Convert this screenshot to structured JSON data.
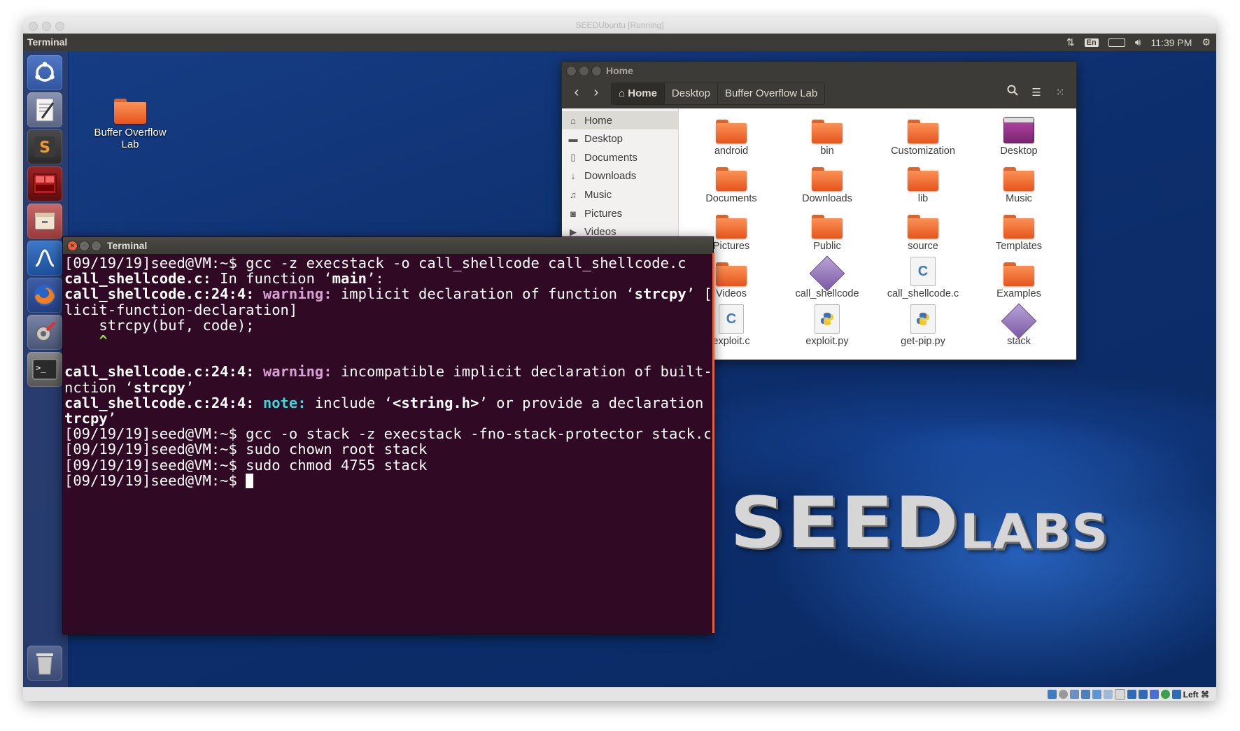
{
  "vm_window": {
    "title": "SEEDUbuntu [Running]"
  },
  "topbar": {
    "app_name": "Terminal",
    "keyboard_layout": "En",
    "clock": "11:39 PM",
    "icons": [
      "network-updown-icon",
      "keyboard-layout-icon",
      "battery-icon",
      "volume-icon",
      "power-gear-icon"
    ]
  },
  "launcher": {
    "items": [
      {
        "name": "ubuntu-dash-icon"
      },
      {
        "name": "text-editor-icon"
      },
      {
        "name": "sublime-text-icon"
      },
      {
        "name": "terminal-red-icon"
      },
      {
        "name": "file-manager-icon"
      },
      {
        "name": "wireshark-icon"
      },
      {
        "name": "firefox-icon"
      },
      {
        "name": "settings-icon"
      },
      {
        "name": "terminal-icon"
      },
      {
        "name": "trash-icon"
      }
    ]
  },
  "desktop": {
    "icon_label_line1": "Buffer Overflow",
    "icon_label_line2": "Lab"
  },
  "terminal": {
    "title": "Terminal",
    "lines": {
      "l1": "[09/19/19]seed@VM:~$ gcc -z execstack -o call_shellcode call_shellcode.c",
      "l2_file": "call_shellcode.c:",
      "l2_text": " In function ‘",
      "l2_func": "main",
      "l2_end": "’:",
      "l3_loc": "call_shellcode.c:24:4:",
      "l3_kind": " warning:",
      "l3_text": " implicit declaration of function ‘",
      "l3_func": "strcpy",
      "l3_end": "’ [-Wimp",
      "l4": "licit-function-declaration]",
      "l5": "    strcpy(buf, code);",
      "l6": "    ^",
      "l7": "",
      "l8_loc": "call_shellcode.c:24:4:",
      "l8_kind": " warning:",
      "l8_text": " incompatible implicit declaration of built-in fu",
      "l9_text": "nction ‘",
      "l9_func": "strcpy",
      "l9_end": "’",
      "l10_loc": "call_shellcode.c:24:4:",
      "l10_kind": " note:",
      "l10_text": " include ‘",
      "l10_hdr": "<string.h>",
      "l10_mid": "’ or provide a declaration of ‘",
      "l10_s": "s",
      "l11_func": "trcpy",
      "l11_end": "’",
      "l12": "[09/19/19]seed@VM:~$ gcc -o stack -z execstack -fno-stack-protector stack.c",
      "l13": "[09/19/19]seed@VM:~$ sudo chown root stack",
      "l14": "[09/19/19]seed@VM:~$ sudo chmod 4755 stack",
      "l15": "[09/19/19]seed@VM:~$ "
    }
  },
  "file_manager": {
    "title": "Home",
    "breadcrumbs": [
      "Home",
      "Desktop",
      "Buffer Overflow Lab"
    ],
    "sidebar": [
      {
        "label": "Home",
        "icon": "home-icon"
      },
      {
        "label": "Desktop",
        "icon": "desktop-icon"
      },
      {
        "label": "Documents",
        "icon": "document-icon"
      },
      {
        "label": "Downloads",
        "icon": "download-icon"
      },
      {
        "label": "Music",
        "icon": "music-icon"
      },
      {
        "label": "Pictures",
        "icon": "camera-icon"
      },
      {
        "label": "Videos",
        "icon": "video-icon"
      }
    ],
    "items": [
      {
        "label": "android",
        "kind": "folder"
      },
      {
        "label": "bin",
        "kind": "folder"
      },
      {
        "label": "Customization",
        "kind": "folder"
      },
      {
        "label": "Desktop",
        "kind": "desktop-folder"
      },
      {
        "label": "Documents",
        "kind": "folder"
      },
      {
        "label": "Downloads",
        "kind": "folder"
      },
      {
        "label": "lib",
        "kind": "folder"
      },
      {
        "label": "Music",
        "kind": "folder"
      },
      {
        "label": "Pictures",
        "kind": "folder"
      },
      {
        "label": "Public",
        "kind": "folder"
      },
      {
        "label": "source",
        "kind": "folder"
      },
      {
        "label": "Templates",
        "kind": "folder"
      },
      {
        "label": "Videos",
        "kind": "folder"
      },
      {
        "label": "call_shellcode",
        "kind": "executable"
      },
      {
        "label": "call_shellcode.c",
        "kind": "c-source"
      },
      {
        "label": "Examples",
        "kind": "folder-link"
      },
      {
        "label": "exploit.c",
        "kind": "c-source"
      },
      {
        "label": "exploit.py",
        "kind": "python"
      },
      {
        "label": "get-pip.py",
        "kind": "python"
      },
      {
        "label": "stack",
        "kind": "executable"
      }
    ]
  },
  "wallpaper": {
    "logo_big": "SEED",
    "logo_small": "LABS"
  },
  "statusbar": {
    "host_key": "Left ⌘"
  }
}
